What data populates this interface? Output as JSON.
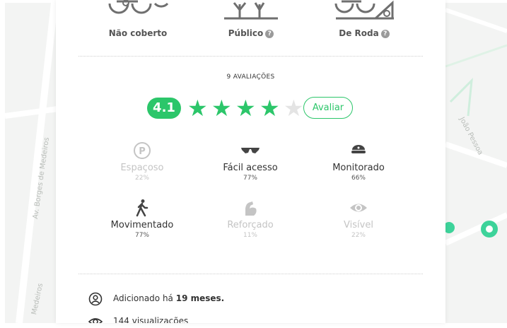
{
  "place_types": [
    {
      "label": "Não coberto",
      "has_help": false,
      "icon": "bike-rack-open-icon"
    },
    {
      "label": "Público",
      "has_help": true,
      "icon": "public-tree-icon"
    },
    {
      "label": "De Roda",
      "has_help": true,
      "icon": "wheel-rack-icon"
    }
  ],
  "reviews": {
    "count_label": "9 AVALIAÇÕES",
    "average": "4.1",
    "stars_filled": 4,
    "stars_total": 5,
    "rate_button": "Avaliar"
  },
  "attributes": [
    {
      "name": "Espaçoso",
      "percent": "22%",
      "active": false,
      "icon": "parking-icon"
    },
    {
      "name": "Fácil acesso",
      "percent": "77%",
      "active": true,
      "icon": "sunglasses-icon"
    },
    {
      "name": "Monitorado",
      "percent": "66%",
      "active": true,
      "icon": "guard-cap-icon"
    },
    {
      "name": "Movimentado",
      "percent": "77%",
      "active": true,
      "icon": "walking-person-icon"
    },
    {
      "name": "Reforçado",
      "percent": "11%",
      "active": false,
      "icon": "strong-arm-icon"
    },
    {
      "name": "Visível",
      "percent": "22%",
      "active": false,
      "icon": "eye-icon"
    }
  ],
  "info": {
    "added_prefix": "Adicionado há ",
    "added_bold": "19 meses.",
    "views": "144 visualizações"
  },
  "map_labels": [
    "Av. Borges de Medeiros",
    "João Pessoa",
    "Medeiros"
  ],
  "colors": {
    "accent": "#2cc66a",
    "muted": "#c4c4c4",
    "text": "#333333"
  }
}
